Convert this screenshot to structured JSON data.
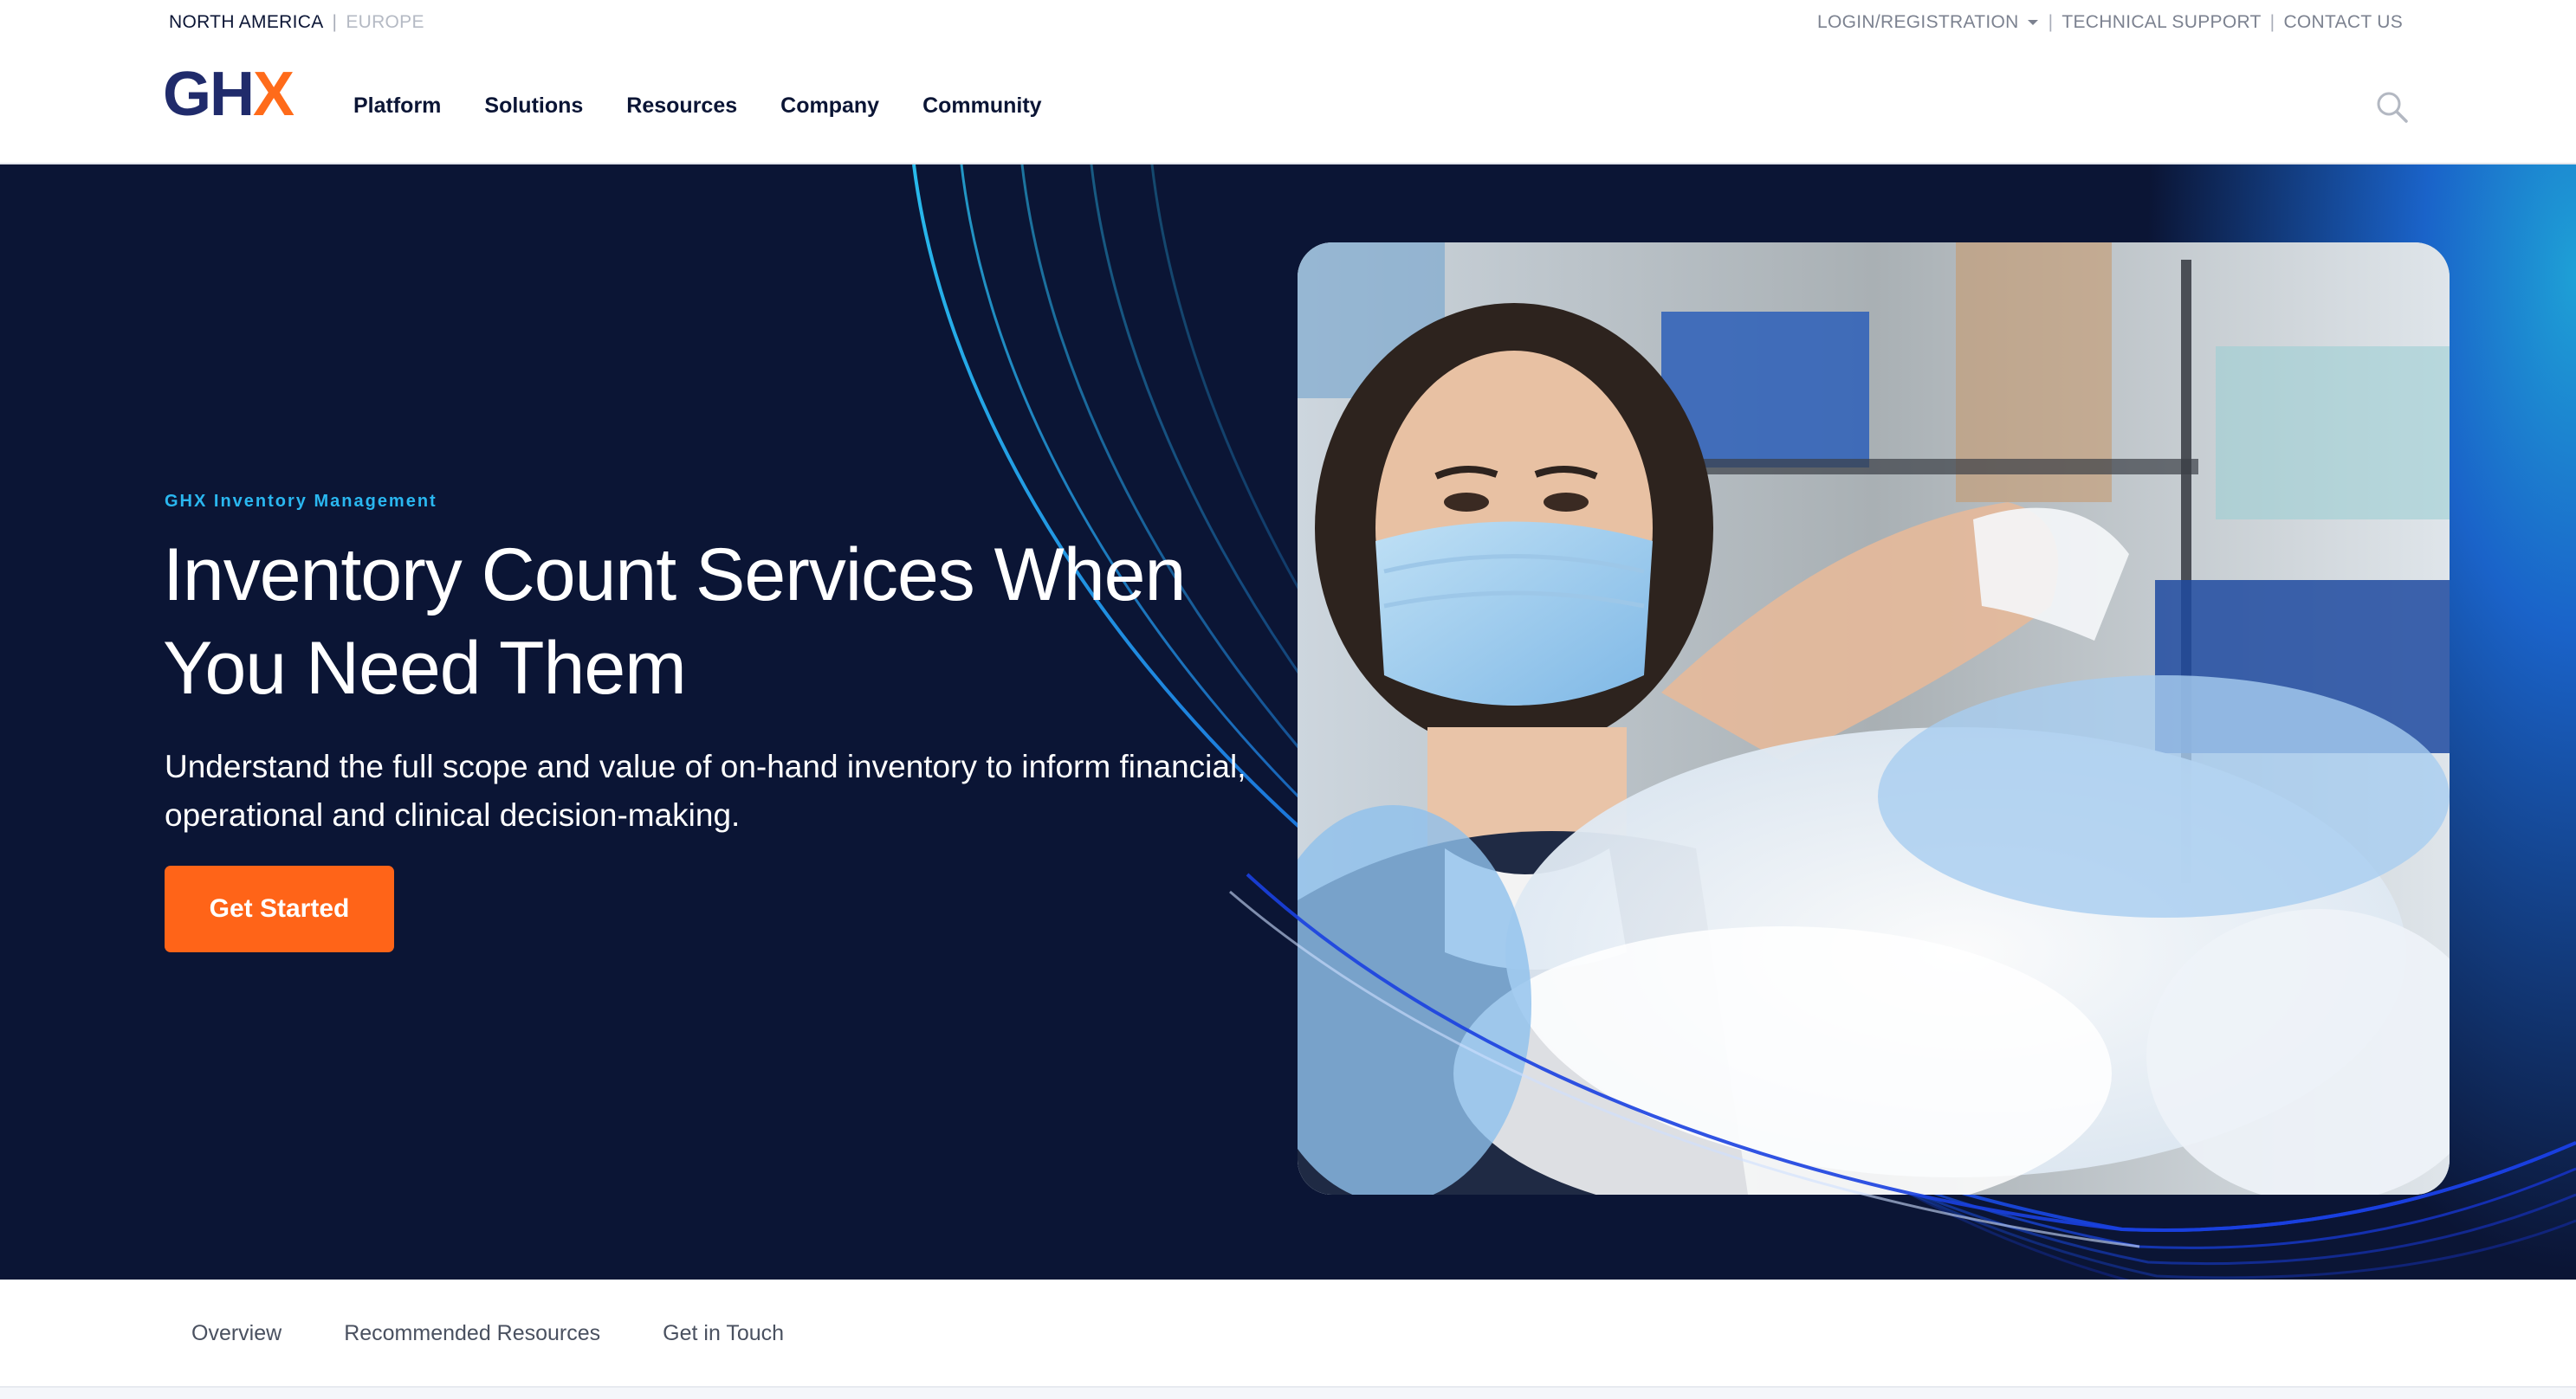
{
  "utility_bar": {
    "region_active": "NORTH AMERICA",
    "region_separator": "|",
    "region_inactive": "EUROPE",
    "login_label": "LOGIN/REGISTRATION",
    "support_label": "TECHNICAL SUPPORT",
    "contact_label": "CONTACT US",
    "separator": "|"
  },
  "logo": {
    "text_main": "GH",
    "text_accent": "X"
  },
  "nav": {
    "items": [
      "Platform",
      "Solutions",
      "Resources",
      "Company",
      "Community"
    ],
    "search_icon": "search-icon"
  },
  "hero": {
    "eyebrow": "GHX Inventory Management",
    "title": "Inventory Count Services When You Need Them",
    "subtitle": "Understand the full scope and value of on-hand inventory to inform financial, operational and clinical decision-making.",
    "cta_label": "Get Started"
  },
  "sub_nav": {
    "items": [
      "Overview",
      "Recommended Resources",
      "Get in Touch"
    ]
  },
  "colors": {
    "navy": "#0b1535",
    "brand_blue": "#202b6b",
    "accent_orange": "#ff6418",
    "eyebrow_cyan": "#2ab7f0"
  }
}
